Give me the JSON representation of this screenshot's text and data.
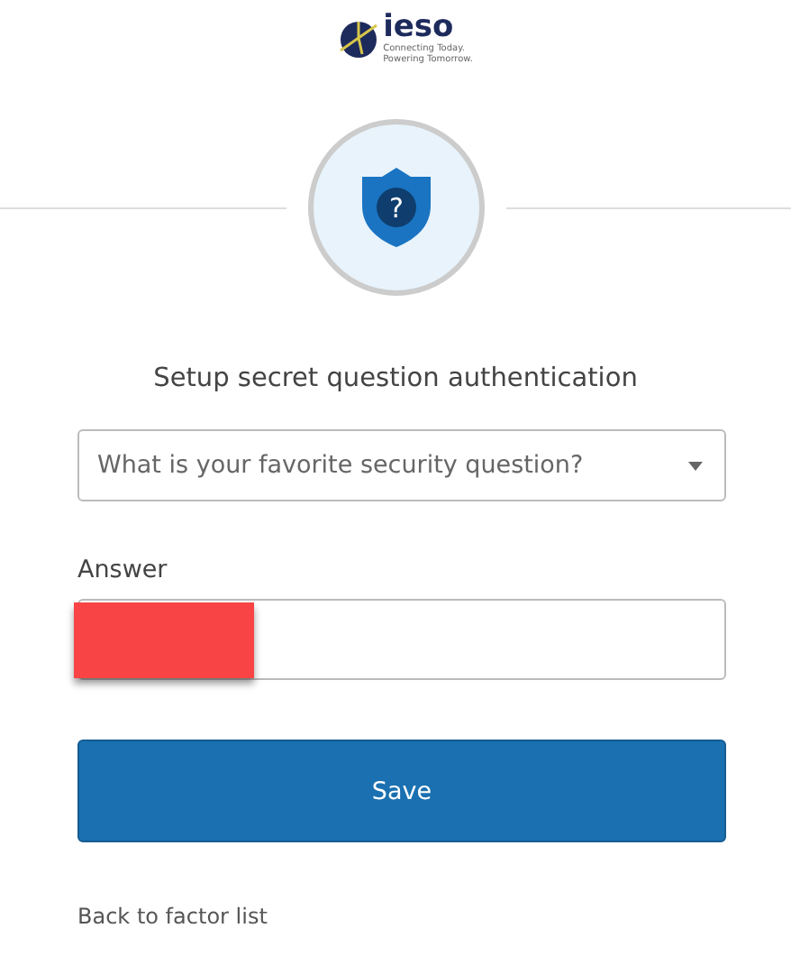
{
  "logo": {
    "name": "ieso",
    "tagline_1": "Connecting Today.",
    "tagline_2": "Powering Tomorrow."
  },
  "factor_badge": {
    "glyph": "?"
  },
  "title": "Setup secret question authentication",
  "question_dropdown": {
    "value": "What is your favorite security question?"
  },
  "answer": {
    "label": "Answer",
    "redacted": true
  },
  "buttons": [
    {
      "label": "Save"
    }
  ],
  "link": "Back to factor list"
}
